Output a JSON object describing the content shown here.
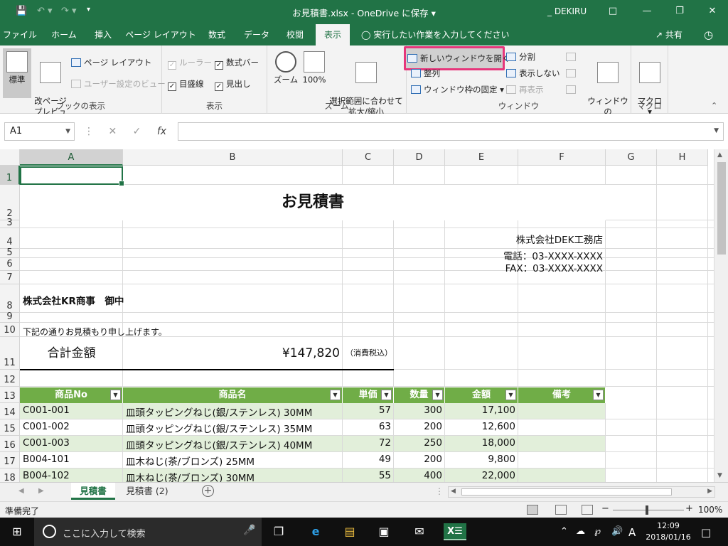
{
  "titlebar": {
    "title": "お見積書.xlsx  -  OneDrive に保存  ▾",
    "user": "_ DEKIRU",
    "qa_customize": "▾"
  },
  "tabs": [
    {
      "label": "ファイル"
    },
    {
      "label": "ホーム"
    },
    {
      "label": "挿入"
    },
    {
      "label": "ページ レイアウト"
    },
    {
      "label": "数式"
    },
    {
      "label": "データ"
    },
    {
      "label": "校閲"
    },
    {
      "label": "表示"
    }
  ],
  "tell_me": "実行したい作業を入力してください",
  "share": "共有",
  "ribbon": {
    "group_book_views": {
      "label": "ブックの表示",
      "normal": "標準",
      "page_break_preview": "改ページ\nプレビュー",
      "page_layout": "ページ レイアウト",
      "custom_views": "ユーザー設定のビュー"
    },
    "group_show": {
      "label": "表示",
      "ruler": "ルーラー",
      "formula_bar": "数式バー",
      "gridlines": "目盛線",
      "headings": "見出し"
    },
    "group_zoom": {
      "label": "ズーム",
      "zoom": "ズーム",
      "zoom100": "100%",
      "zoom_selection": "選択範囲に合わせて\n拡大/縮小"
    },
    "group_window": {
      "label": "ウィンドウ",
      "new_window": "新しいウィンドウを開く",
      "arrange_all": "整列",
      "freeze_panes": "ウィンドウ枠の固定 ▾",
      "split": "分割",
      "hide": "表示しない",
      "unhide": "再表示",
      "switch_windows": "ウィンドウの\n切り替え ▾"
    },
    "group_macros": {
      "label": "マクロ",
      "macros": "マクロ\n▾"
    }
  },
  "formula_bar": {
    "name_box": "A1",
    "fx": "fx",
    "content": ""
  },
  "columns": [
    "A",
    "B",
    "C",
    "D",
    "E",
    "F",
    "G",
    "H"
  ],
  "rows": [
    "1",
    "2",
    "3",
    "4",
    "5",
    "6",
    "7",
    "8",
    "9",
    "10",
    "11",
    "12",
    "13",
    "14",
    "15",
    "16",
    "17",
    "18"
  ],
  "sheet": {
    "title": "お見積書",
    "company": "株式会社DEK工務店",
    "phone": "電話：03-XXXX-XXXX",
    "fax": "FAX：03-XXXX-XXXX",
    "client": "株式会社KR商事　御中",
    "intro": "下記の通りお見積もり申し上げます。",
    "total_label": "合計金額",
    "total_value": "¥147,820",
    "tax_note": "（消費税込）",
    "table_headers": [
      "商品No",
      "商品名",
      "単価",
      "数量",
      "金額",
      "備考"
    ],
    "table_rows": [
      [
        "C001-001",
        "皿頭タッピングねじ(銀/ステンレス) 30MM",
        "57",
        "300",
        "17,100",
        ""
      ],
      [
        "C001-002",
        "皿頭タッピングねじ(銀/ステンレス) 35MM",
        "63",
        "200",
        "12,600",
        ""
      ],
      [
        "C001-003",
        "皿頭タッピングねじ(銀/ステンレス) 40MM",
        "72",
        "250",
        "18,000",
        ""
      ],
      [
        "B004-101",
        "皿木ねじ(茶/ブロンズ) 25MM",
        "49",
        "200",
        "9,800",
        ""
      ],
      [
        "B004-102",
        "皿木ねじ(茶/ブロンズ) 30MM",
        "55",
        "400",
        "22,000",
        ""
      ]
    ]
  },
  "sheet_tabs": [
    "見積書",
    "見積書 (2)"
  ],
  "status": {
    "ready": "準備完了",
    "zoom": "100%"
  },
  "taskbar": {
    "search_placeholder": "ここに入力して検索",
    "time": "12:09",
    "date": "2018/01/16",
    "ime": "A"
  },
  "colors": {
    "excel_green": "#217346",
    "table_header": "#70ad47",
    "table_band": "#e2efda",
    "highlight": "#e6367b"
  }
}
